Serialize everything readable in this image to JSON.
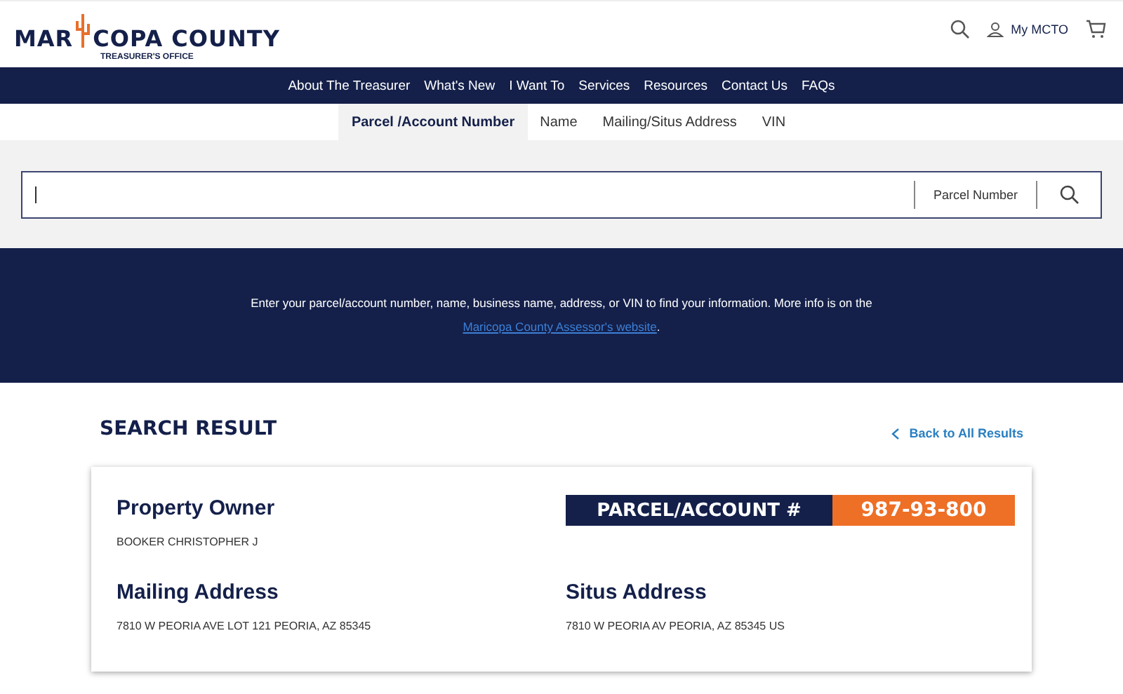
{
  "logo": {
    "left": "MAR",
    "right": "COPA COUNTY",
    "subtitle": "TREASURER'S OFFICE"
  },
  "header": {
    "account_label": "My MCTO"
  },
  "nav": [
    "About The Treasurer",
    "What's New",
    "I Want To",
    "Services",
    "Resources",
    "Contact Us",
    "FAQs"
  ],
  "search_tabs": [
    {
      "label": "Parcel /Account Number",
      "selected": true
    },
    {
      "label": "Name",
      "selected": false
    },
    {
      "label": "Mailing/Situs Address",
      "selected": false
    },
    {
      "label": "VIN",
      "selected": false
    }
  ],
  "search": {
    "type": "Parcel Number"
  },
  "info": {
    "text": "Enter your parcel/account number, name, business name, address, or VIN to find your information. More info is on the",
    "link": "Maricopa County Assessor's website",
    "end": "."
  },
  "result": {
    "title": "SEARCH RESULT",
    "back": "Back to All Results",
    "owner_label": "Property Owner",
    "owner": "BOOKER CHRISTOPHER J",
    "parcel_label": "PARCEL/ACCOUNT #",
    "parcel": "987-93-800",
    "mailing_label": "Mailing Address",
    "mailing": "7810 W PEORIA AVE LOT 121 PEORIA, AZ 85345",
    "situs_label": "Situs Address",
    "situs": "7810 W PEORIA AV PEORIA, AZ 85345 US"
  }
}
